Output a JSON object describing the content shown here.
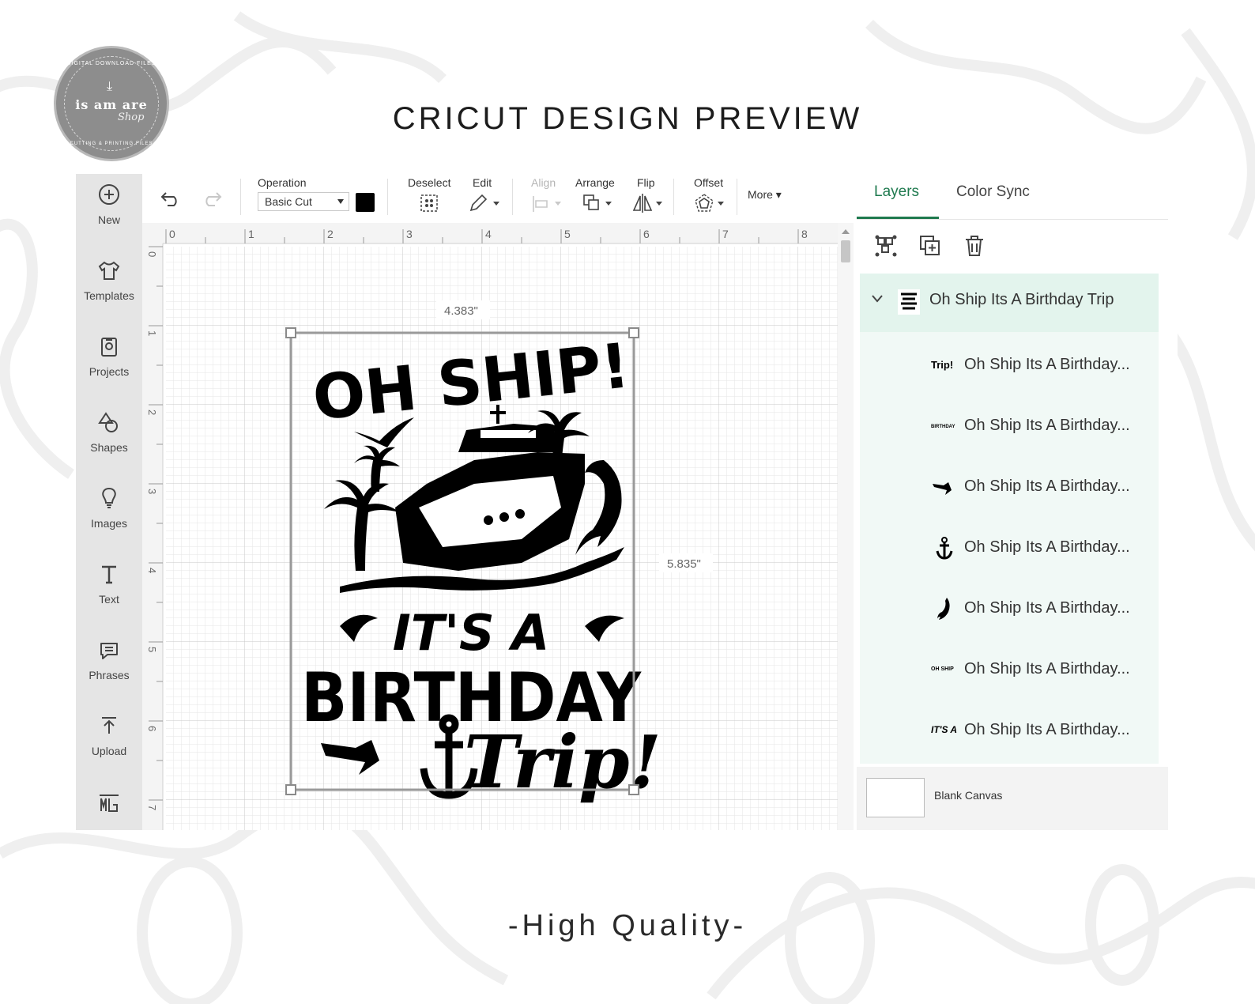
{
  "logo": {
    "top_text": "DIGITAL DOWNLOAD FILES",
    "main_text": "is am are",
    "sub_text": "Shop",
    "bottom_text": "CUTTING & PRINTING FILES"
  },
  "heading": "CRICUT DESIGN PREVIEW",
  "footer": "-High Quality-",
  "sidebar": {
    "items": [
      {
        "label": "New",
        "icon": "plus-circle-icon"
      },
      {
        "label": "Templates",
        "icon": "shirt-icon"
      },
      {
        "label": "Projects",
        "icon": "projects-icon"
      },
      {
        "label": "Shapes",
        "icon": "shapes-icon"
      },
      {
        "label": "Images",
        "icon": "lightbulb-icon"
      },
      {
        "label": "Text",
        "icon": "text-icon"
      },
      {
        "label": "Phrases",
        "icon": "speech-bubble-icon"
      },
      {
        "label": "Upload",
        "icon": "upload-icon"
      },
      {
        "label": "",
        "icon": "monogram-icon"
      }
    ]
  },
  "toolbar": {
    "operation_label": "Operation",
    "operation_value": "Basic Cut",
    "operation_color": "#000000",
    "deselect_label": "Deselect",
    "edit_label": "Edit",
    "align_label": "Align",
    "arrange_label": "Arrange",
    "flip_label": "Flip",
    "offset_label": "Offset",
    "more_label": "More"
  },
  "canvas": {
    "ruler_top": [
      "0",
      "1",
      "2",
      "3",
      "4",
      "5",
      "6",
      "7",
      "8"
    ],
    "ruler_left": [
      "0",
      "1",
      "2",
      "3",
      "4",
      "5",
      "6",
      "7"
    ],
    "width_label": "4.383\"",
    "height_label": "5.835\"",
    "design": {
      "line1": "OH SHIP!",
      "line2": "IT'S A",
      "line3": "BIRTHDAY",
      "line4": "Trip!"
    }
  },
  "panel": {
    "tabs": [
      "Layers",
      "Color Sync"
    ],
    "active_tab": "Layers",
    "accent_color": "#1f7a4f",
    "group_name": "Oh Ship Its A Birthday Trip",
    "layers": [
      {
        "thumb": "Trip!",
        "name": "Oh Ship Its A Birthday..."
      },
      {
        "thumb": "BIRTHDAY",
        "name": "Oh Ship Its A Birthday..."
      },
      {
        "thumb": "arrow",
        "name": "Oh Ship Its A Birthday..."
      },
      {
        "thumb": "anchor",
        "name": "Oh Ship Its A Birthday..."
      },
      {
        "thumb": "dolphin",
        "name": "Oh Ship Its A Birthday..."
      },
      {
        "thumb": "OH SHIP",
        "name": "Oh Ship Its A Birthday..."
      },
      {
        "thumb": "IT'S A",
        "name": "Oh Ship Its A Birthday..."
      }
    ],
    "blank_canvas_label": "Blank Canvas"
  }
}
